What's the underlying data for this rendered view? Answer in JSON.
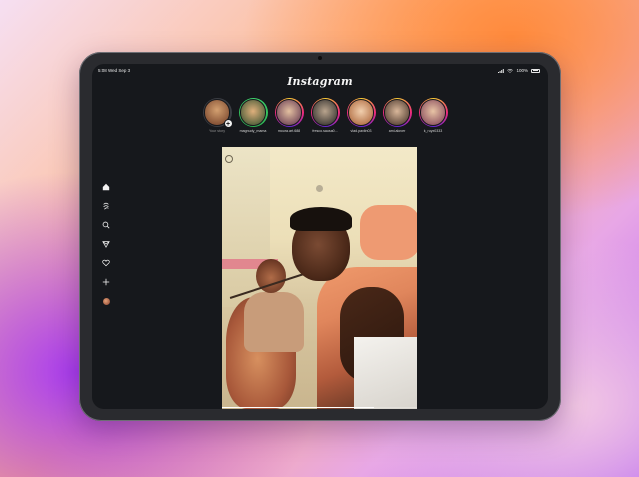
{
  "status_bar": {
    "time": "5:08 Wed Sep 3",
    "battery": "100%"
  },
  "app": {
    "title": "Instagram"
  },
  "sidebar": {
    "items": [
      {
        "name": "home",
        "icon": "home-icon"
      },
      {
        "name": "reels",
        "icon": "reels-icon"
      },
      {
        "name": "search",
        "icon": "search-icon"
      },
      {
        "name": "messages",
        "icon": "send-icon"
      },
      {
        "name": "activity",
        "icon": "heart-icon"
      },
      {
        "name": "create",
        "icon": "plus-icon"
      },
      {
        "name": "profile",
        "icon": "avatar"
      }
    ]
  },
  "stories": [
    {
      "label": "Your story",
      "ring": "own"
    },
    {
      "label": "magnudy_mama",
      "ring": "green"
    },
    {
      "label": "moura.art.688",
      "ring": "gradient"
    },
    {
      "label": "fresco.sausa0...",
      "ring": "gradient"
    },
    {
      "label": "vlad.pavlin03",
      "ring": "gradient"
    },
    {
      "label": "ami.alover",
      "ring": "gradient"
    },
    {
      "label": "k_ruyx0333",
      "ring": "gradient"
    }
  ],
  "post": {
    "progress": 0.78
  },
  "colors": {
    "screen_bg": "#16181c",
    "story_ring": "#ee2a7b",
    "text": "#f4f4f4"
  }
}
